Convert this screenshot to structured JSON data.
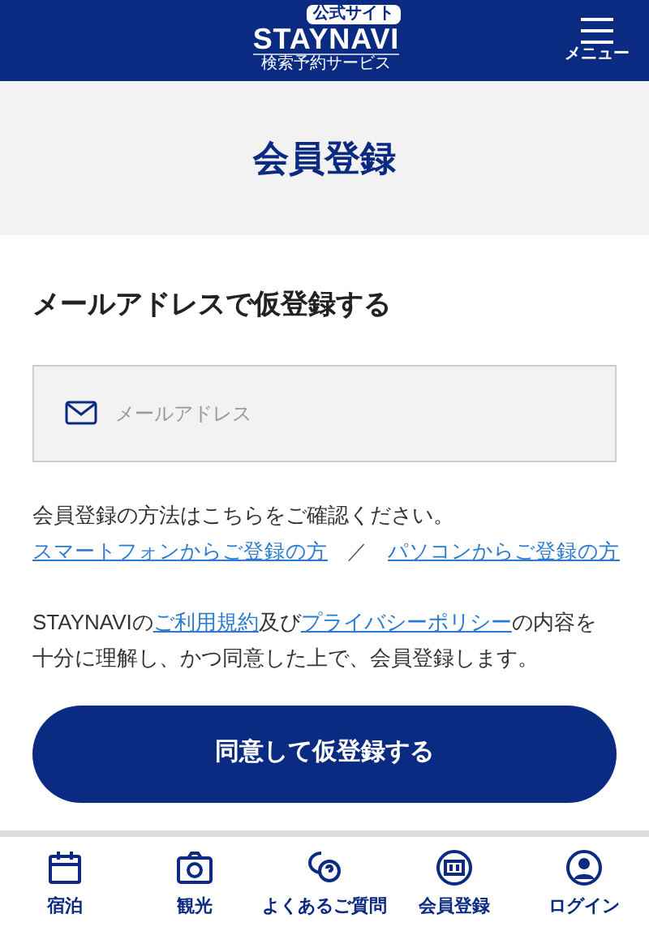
{
  "header": {
    "logo": {
      "badge": "公式サイト",
      "name": "STAYNAVI",
      "subtitle": "検索予約サービス"
    },
    "menu_label": "メニュー"
  },
  "page_title": "会員登録",
  "section_title": "メールアドレスで仮登録する",
  "email_field": {
    "placeholder": "メールアドレス"
  },
  "info_text": "会員登録の方法はこちらをご確認ください。",
  "guide_links": [
    "スマートフォンからご登録の方",
    "パソコンからご登録の方"
  ],
  "guide_separator": "／",
  "agreement": [
    {
      "kind": "text",
      "text": "STAYNAVIの"
    },
    {
      "kind": "link",
      "text": "ご利用規約"
    },
    {
      "kind": "text",
      "text": "及び"
    },
    {
      "kind": "link",
      "text": "プライバシーポリシー"
    },
    {
      "kind": "text",
      "text": "の内容を十分に理解し、かつ同意した上で、会員登録します。"
    }
  ],
  "submit_button": "同意して仮登録する",
  "bottom_nav": [
    {
      "kind": "calendar",
      "label": "宿泊"
    },
    {
      "kind": "camera",
      "label": "観光"
    },
    {
      "kind": "faq",
      "label": "よくあるご質問"
    },
    {
      "kind": "member",
      "label": "会員登録"
    },
    {
      "kind": "user",
      "label": "ログイン"
    }
  ]
}
